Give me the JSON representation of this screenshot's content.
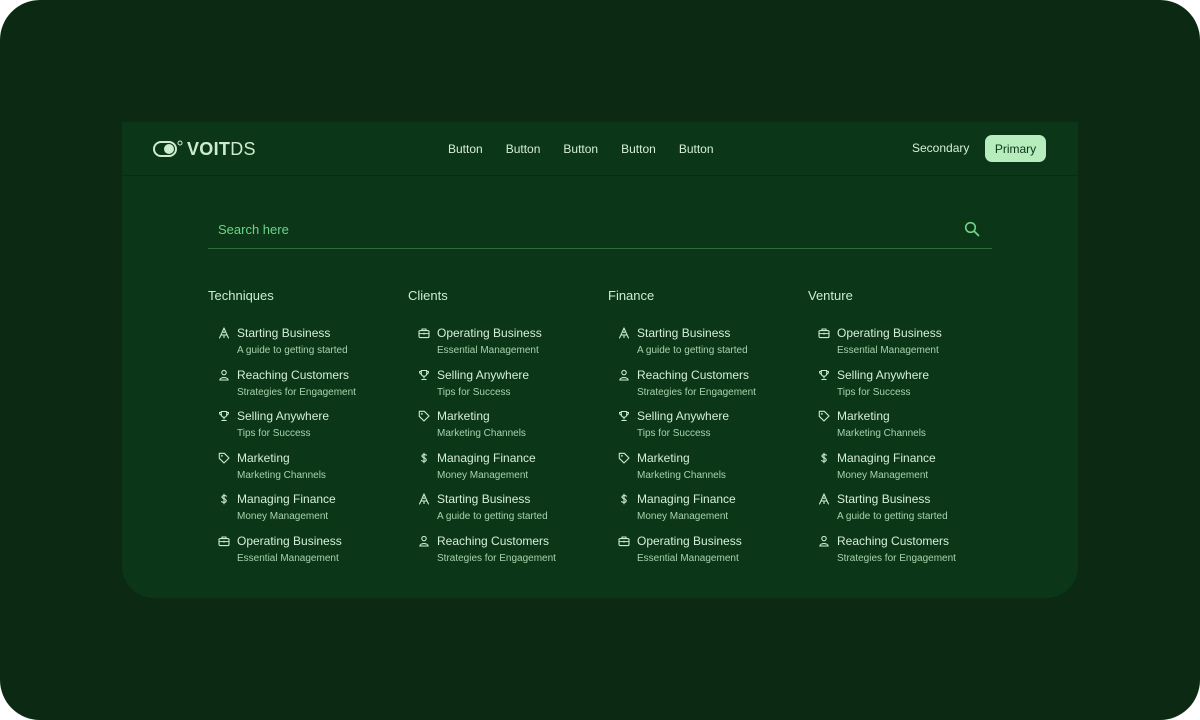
{
  "colors": {
    "background": "#0c2a13",
    "panel": "#0b3617",
    "accent": "#b7ecbd",
    "search_text": "#6fd488"
  },
  "header": {
    "logo_bold": "VOIT",
    "logo_light": "DS",
    "nav": [
      "Button",
      "Button",
      "Button",
      "Button",
      "Button"
    ],
    "secondary_label": "Secondary",
    "primary_label": "Primary"
  },
  "search": {
    "placeholder": "Search here"
  },
  "columns": [
    {
      "title": "Techniques",
      "items": [
        {
          "icon": "rocket-icon",
          "title": "Starting Business",
          "subtitle": "A guide to getting started"
        },
        {
          "icon": "user-icon",
          "title": "Reaching Customers",
          "subtitle": "Strategies for Engagement"
        },
        {
          "icon": "trophy-icon",
          "title": "Selling Anywhere",
          "subtitle": "Tips for Success"
        },
        {
          "icon": "tag-icon",
          "title": "Marketing",
          "subtitle": "Marketing Channels"
        },
        {
          "icon": "dollar-icon",
          "title": "Managing Finance",
          "subtitle": "Money Management"
        },
        {
          "icon": "briefcase-icon",
          "title": "Operating Business",
          "subtitle": "Essential Management"
        }
      ]
    },
    {
      "title": "Clients",
      "items": [
        {
          "icon": "briefcase-icon",
          "title": "Operating Business",
          "subtitle": "Essential Management"
        },
        {
          "icon": "trophy-icon",
          "title": "Selling Anywhere",
          "subtitle": "Tips for Success"
        },
        {
          "icon": "tag-icon",
          "title": "Marketing",
          "subtitle": "Marketing Channels"
        },
        {
          "icon": "dollar-icon",
          "title": "Managing Finance",
          "subtitle": "Money Management"
        },
        {
          "icon": "rocket-icon",
          "title": "Starting Business",
          "subtitle": "A guide to getting started"
        },
        {
          "icon": "user-icon",
          "title": "Reaching Customers",
          "subtitle": "Strategies for Engagement"
        }
      ]
    },
    {
      "title": "Finance",
      "items": [
        {
          "icon": "rocket-icon",
          "title": "Starting Business",
          "subtitle": "A guide to getting started"
        },
        {
          "icon": "user-icon",
          "title": "Reaching Customers",
          "subtitle": "Strategies for Engagement"
        },
        {
          "icon": "trophy-icon",
          "title": "Selling Anywhere",
          "subtitle": "Tips for Success"
        },
        {
          "icon": "tag-icon",
          "title": "Marketing",
          "subtitle": "Marketing Channels"
        },
        {
          "icon": "dollar-icon",
          "title": "Managing Finance",
          "subtitle": "Money Management"
        },
        {
          "icon": "briefcase-icon",
          "title": "Operating Business",
          "subtitle": "Essential Management"
        }
      ]
    },
    {
      "title": "Venture",
      "items": [
        {
          "icon": "briefcase-icon",
          "title": "Operating Business",
          "subtitle": "Essential Management"
        },
        {
          "icon": "trophy-icon",
          "title": "Selling Anywhere",
          "subtitle": "Tips for Success"
        },
        {
          "icon": "tag-icon",
          "title": "Marketing",
          "subtitle": "Marketing Channels"
        },
        {
          "icon": "dollar-icon",
          "title": "Managing Finance",
          "subtitle": "Money Management"
        },
        {
          "icon": "rocket-icon",
          "title": "Starting Business",
          "subtitle": "A guide to getting started"
        },
        {
          "icon": "user-icon",
          "title": "Reaching Customers",
          "subtitle": "Strategies for Engagement"
        }
      ]
    }
  ]
}
